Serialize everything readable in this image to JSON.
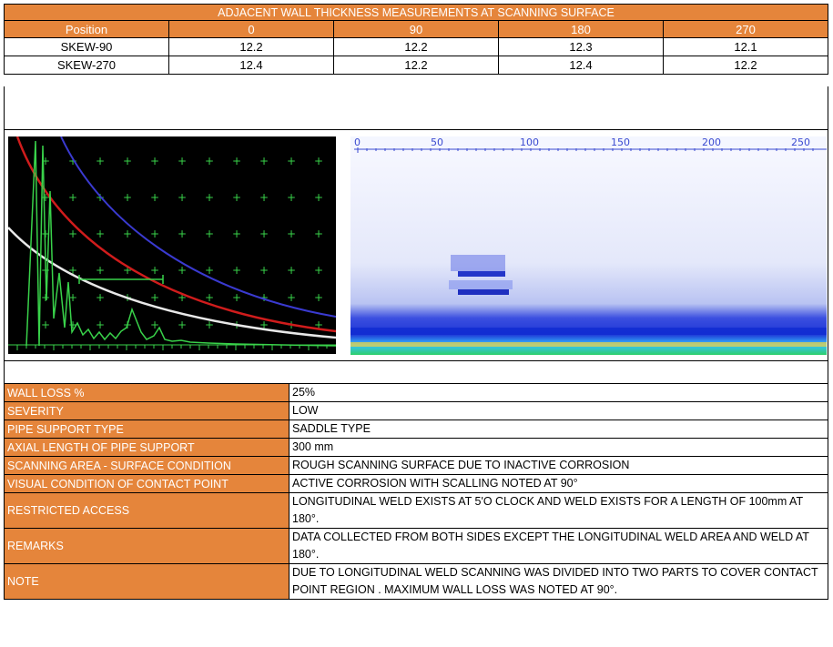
{
  "title": "ADJACENT WALL THICKNESS MEASUREMENTS AT SCANNING SURFACE",
  "headers": [
    "Position",
    "0",
    "90",
    "180",
    "270"
  ],
  "rows": [
    [
      "SKEW-90",
      "12.2",
      "12.2",
      "12.3",
      "12.1"
    ],
    [
      "SKEW-270",
      "12.4",
      "12.2",
      "12.4",
      "12.2"
    ]
  ],
  "bscan_ticks": [
    "0",
    "50",
    "100",
    "150",
    "200",
    "250"
  ],
  "details": [
    {
      "label": "WALL LOSS %",
      "value": "25%"
    },
    {
      "label": "SEVERITY",
      "value": "LOW"
    },
    {
      "label": "PIPE SUPPORT TYPE",
      "value": "SADDLE TYPE"
    },
    {
      "label": "AXIAL LENGTH OF PIPE SUPPORT",
      "value": "300 mm"
    },
    {
      "label": "SCANNING AREA - SURFACE CONDITION",
      "value": "ROUGH SCANNING SURFACE DUE TO INACTIVE CORROSION"
    },
    {
      "label": "VISUAL CONDITION OF CONTACT POINT",
      "value": "ACTIVE CORROSION WITH SCALLING NOTED AT 90°"
    },
    {
      "label": "RESTRICTED ACCESS",
      "value": "LONGITUDINAL WELD EXISTS AT 5'O CLOCK AND WELD EXISTS FOR A LENGTH OF 100mm AT 180°."
    },
    {
      "label": "REMARKS",
      "value": "DATA COLLECTED FROM BOTH SIDES  EXCEPT THE LONGITUDINAL WELD AREA AND WELD AT 180°."
    },
    {
      "label": "NOTE",
      "value": " DUE TO LONGITUDINAL WELD SCANNING WAS DIVIDED INTO TWO PARTS TO COVER CONTACT POINT REGION . MAXIMUM WALL LOSS WAS NOTED AT 90°."
    }
  ],
  "colors": {
    "header": "#e5853b"
  }
}
